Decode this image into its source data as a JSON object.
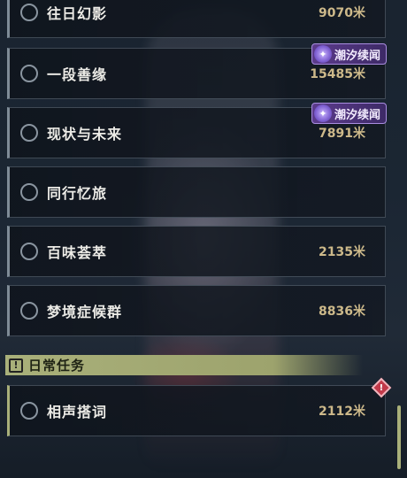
{
  "quests": [
    {
      "name": "往日幻影",
      "distance": "9070米",
      "tag": ""
    },
    {
      "name": "一段善缘",
      "distance": "15485米",
      "tag": "潮汐续闻"
    },
    {
      "name": "现状与未来",
      "distance": "7891米",
      "tag": "潮汐续闻"
    },
    {
      "name": "同行忆旅",
      "distance": "",
      "tag": ""
    },
    {
      "name": "百味荟萃",
      "distance": "2135米",
      "tag": ""
    },
    {
      "name": "梦境症候群",
      "distance": "8836米",
      "tag": ""
    }
  ],
  "daily_section": {
    "title": "日常任务",
    "icon": "!",
    "quests": [
      {
        "name": "相声搭词",
        "distance": "2112米"
      }
    ]
  },
  "colors": {
    "daily_accent": "#a9b07a",
    "distance_text": "#cdb98a",
    "tag_purple": "#5c3b8c",
    "alert_red": "#c23a4a"
  }
}
